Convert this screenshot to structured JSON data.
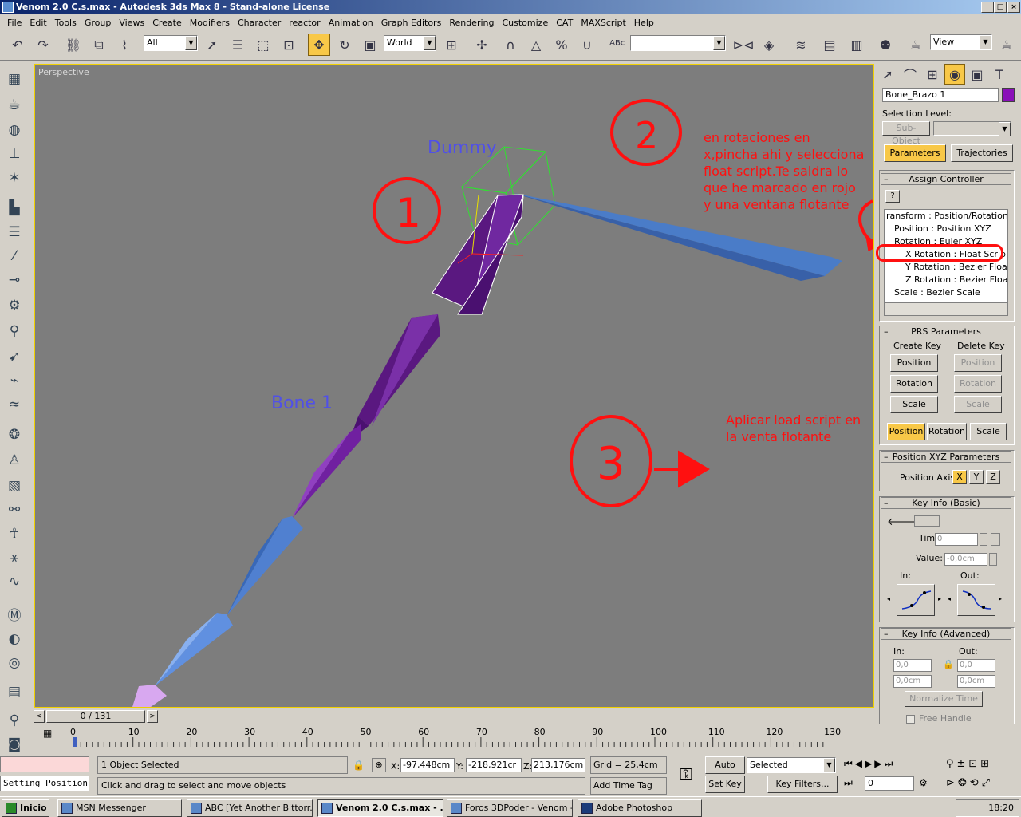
{
  "window": {
    "title": "Venom 2.0 C.s.max - Autodesk 3ds Max 8  - Stand-alone License"
  },
  "menu": [
    "File",
    "Edit",
    "Tools",
    "Group",
    "Views",
    "Create",
    "Modifiers",
    "Character",
    "reactor",
    "Animation",
    "Graph Editors",
    "Rendering",
    "Customize",
    "CAT",
    "MAXScript",
    "Help"
  ],
  "toolbar": {
    "filter": "All",
    "coord_system": "World",
    "named_sel": "",
    "viewport_select": "View"
  },
  "viewport": {
    "label": "Perspective",
    "dummy_label": "Dummy",
    "bone_label": "Bone 1"
  },
  "annotations": {
    "num1": "1",
    "num2": "2",
    "num3": "3",
    "text2_l1": "en rotaciones en",
    "text2_l2": "x,pincha ahi y selecciona",
    "text2_l3": "float script.Te saldra lo",
    "text2_l4": "que he marcado en rojo",
    "text2_l5": "y una ventana flotante",
    "text3_l1": "Aplicar load script en",
    "text3_l2": "la venta flotante"
  },
  "panel": {
    "object_name": "Bone_Brazo 1",
    "selection_level": "Selection Level:",
    "sub_object": "Sub-Object",
    "tab_parameters": "Parameters",
    "tab_trajectories": "Trajectories",
    "assign_controller": "Assign Controller",
    "tree": [
      "ransform : Position/Rotation/",
      "Position : Position XYZ",
      "Rotation : Euler XYZ",
      "X Rotation : Float Scrip",
      "Y Rotation : Bezier Floa",
      "Z Rotation : Bezier Floa",
      "Scale : Bezier Scale"
    ],
    "prs_params": "PRS Parameters",
    "create_key": "Create Key",
    "delete_key": "Delete Key",
    "btn_position": "Position",
    "btn_rotation": "Rotation",
    "btn_scale": "Scale",
    "pos_xyz_params": "Position XYZ Parameters",
    "position_axis": "Position Axis:",
    "axis_x": "X",
    "axis_y": "Y",
    "axis_z": "Z",
    "key_info_basic": "Key Info (Basic)",
    "time_label": "Time:",
    "time_val": "0",
    "value_label": "Value:",
    "value_val": "-0,0cm",
    "in_label": "In:",
    "out_label": "Out:",
    "key_info_adv": "Key Info (Advanced)",
    "adv_in": "0,0",
    "adv_out": "0,0",
    "adv_in2": "0,0cm",
    "adv_out2": "0,0cm",
    "normalize_time": "Normalize Time",
    "free_handle": "Free Handle"
  },
  "timeline": {
    "frame": "0 / 131",
    "ticks": [
      "0",
      "10",
      "20",
      "30",
      "40",
      "50",
      "60",
      "70",
      "80",
      "90",
      "100",
      "110",
      "120",
      "130"
    ]
  },
  "status": {
    "listener": "Setting Position",
    "selected": "1 Object Selected",
    "prompt": "Click and drag to select and move objects",
    "x": "-97,448cm",
    "y": "-218,921cr",
    "z": "213,176cm",
    "grid": "Grid = 25,4cm",
    "add_time_tag": "Add Time Tag",
    "auto_key": "Auto Key",
    "set_key": "Set Key",
    "key_mode": "Selected",
    "key_filters": "Key Filters...",
    "current_frame": "0"
  },
  "taskbar": {
    "start": "Inicio",
    "tasks": [
      "MSN Messenger",
      "ABC [Yet Another Bittorr...",
      "Venom 2.0 C.s.max - ...",
      "Foros 3DPoder - Venom -...",
      "Adobe Photoshop"
    ],
    "clock": "18:20"
  },
  "colors": {
    "accent": "#f8c848",
    "annotation": "#ff1010",
    "viewport_bg": "#7d7d7d",
    "label_blue": "#5050e8"
  }
}
